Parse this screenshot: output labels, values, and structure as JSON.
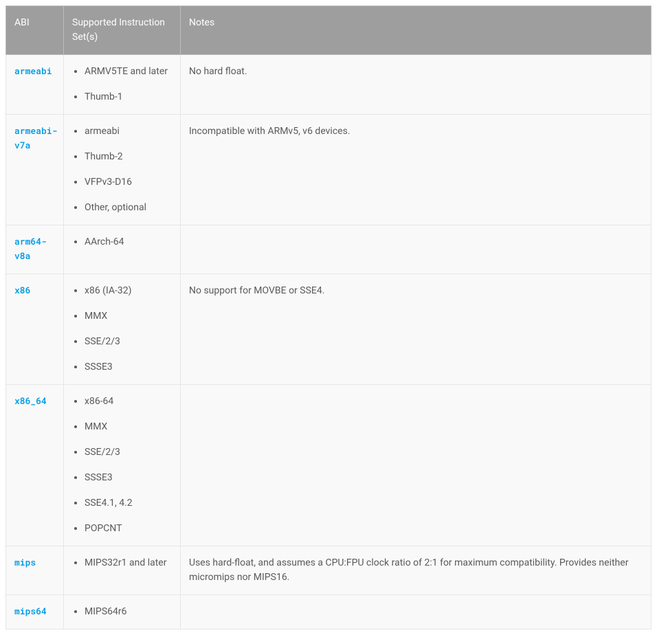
{
  "headers": {
    "abi": "ABI",
    "instruction_sets": "Supported Instruction Set(s)",
    "notes": "Notes"
  },
  "rows": [
    {
      "abi": "armeabi",
      "instruction_sets": [
        "ARMV5TE and later",
        "Thumb-1"
      ],
      "notes": "No hard float."
    },
    {
      "abi": "armeabi-v7a",
      "instruction_sets": [
        "armeabi",
        "Thumb-2",
        "VFPv3-D16",
        "Other, optional"
      ],
      "notes": "Incompatible with ARMv5, v6 devices."
    },
    {
      "abi": "arm64-v8a",
      "instruction_sets": [
        "AArch-64"
      ],
      "notes": ""
    },
    {
      "abi": "x86",
      "instruction_sets": [
        "x86 (IA-32)",
        "MMX",
        "SSE/2/3",
        "SSSE3"
      ],
      "notes": "No support for MOVBE or SSE4."
    },
    {
      "abi": "x86_64",
      "instruction_sets": [
        "x86-64",
        "MMX",
        "SSE/2/3",
        "SSSE3",
        "SSE4.1, 4.2",
        "POPCNT"
      ],
      "notes": ""
    },
    {
      "abi": "mips",
      "instruction_sets": [
        "MIPS32r1 and later"
      ],
      "notes": "Uses hard-float, and assumes a CPU:FPU clock ratio of 2:1 for maximum compatibility. Provides neither micromips nor MIPS16."
    },
    {
      "abi": "mips64",
      "instruction_sets": [
        "MIPS64r6"
      ],
      "notes": ""
    }
  ]
}
